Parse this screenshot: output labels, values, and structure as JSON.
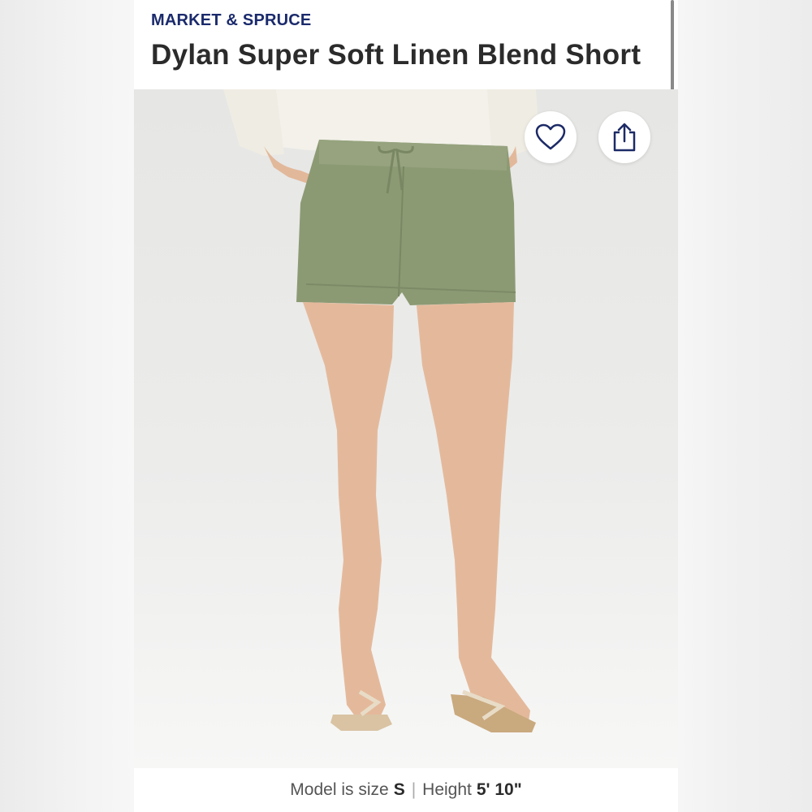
{
  "header": {
    "brand": "MARKET & SPRUCE",
    "title": "Dylan Super Soft Linen Blend Short"
  },
  "actions": {
    "favorite_icon": "heart-icon",
    "share_icon": "share-icon"
  },
  "caption": {
    "size_label": "Model is size",
    "size_value": "S",
    "separator": "|",
    "height_label": "Height",
    "height_value": "5' 10\""
  },
  "colors": {
    "brand": "#1a2a6c",
    "shorts": "#8c9a74",
    "background": "#e9e9e7"
  }
}
